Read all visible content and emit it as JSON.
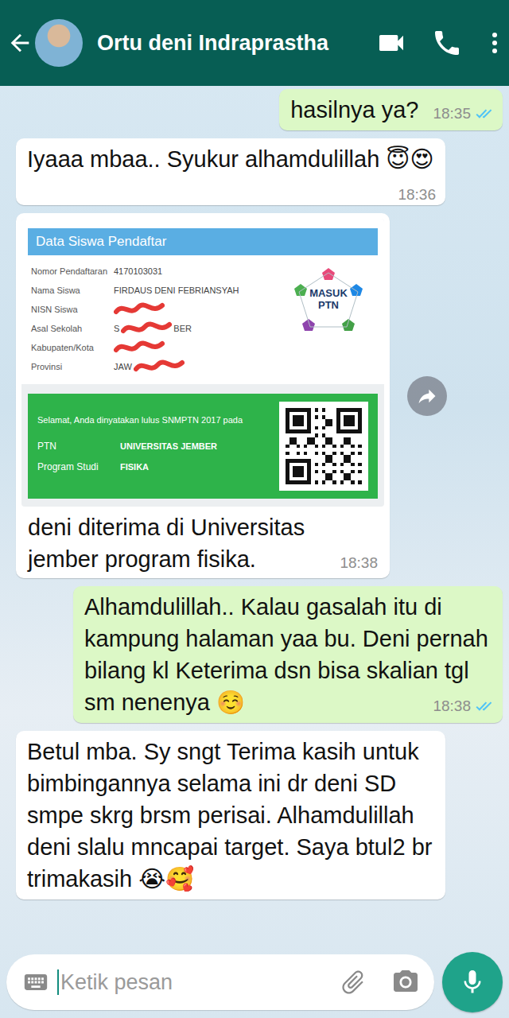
{
  "header": {
    "title": "Ortu deni Indraprastha"
  },
  "messages": [
    {
      "kind": "text",
      "direction": "out",
      "text": "hasilnya ya?",
      "time": "18:35",
      "read": true
    },
    {
      "kind": "text",
      "direction": "in",
      "text": "Iyaaa mbaa.. Syukur alhamdulillah 😇😍",
      "time": "18:36"
    },
    {
      "kind": "image",
      "direction": "in",
      "card": {
        "title": "Data Siswa Pendaftar",
        "logo": "MASUK PTN",
        "fields": [
          {
            "label": "Nomor Pendaftaran",
            "value": "4170103031",
            "redacted": false
          },
          {
            "label": "Nama Siswa",
            "value": "FIRDAUS DENI FEBRIANSYAH",
            "redacted": false
          },
          {
            "label": "NISN Siswa",
            "value": "",
            "redacted": true
          },
          {
            "label": "Asal Sekolah",
            "value": "S",
            "tail": "BER",
            "redacted": true
          },
          {
            "label": "Kabupaten/Kota",
            "value": "",
            "redacted": true
          },
          {
            "label": "Provinsi",
            "value": "JAW",
            "redacted": true
          }
        ],
        "result": {
          "notice": "Selamat, Anda dinyatakan lulus SNMPTN 2017 pada",
          "rows": [
            {
              "label": "PTN",
              "value": "UNIVERSITAS JEMBER"
            },
            {
              "label": "Program Studi",
              "value": "FISIKA"
            }
          ]
        }
      },
      "text": "deni diterima di Universitas jember program fisika.",
      "time": "18:38"
    },
    {
      "kind": "text",
      "direction": "out",
      "text": "Alhamdulillah.. Kalau gasalah itu di kampung halaman yaa bu. Deni pernah bilang kl Keterima dsn bisa skalian tgl sm nenenya ☺️",
      "time": "18:38",
      "read": true
    },
    {
      "kind": "text",
      "direction": "in",
      "text": "Betul mba. Sy sngt Terima kasih untuk bimbingannya selama ini dr deni SD smpe skrg brsm perisai. Alhamdulillah deni slalu mncapai target. Saya btul2 br trimakasih 😭🥰"
    }
  ],
  "input": {
    "placeholder": "Ketik pesan"
  }
}
